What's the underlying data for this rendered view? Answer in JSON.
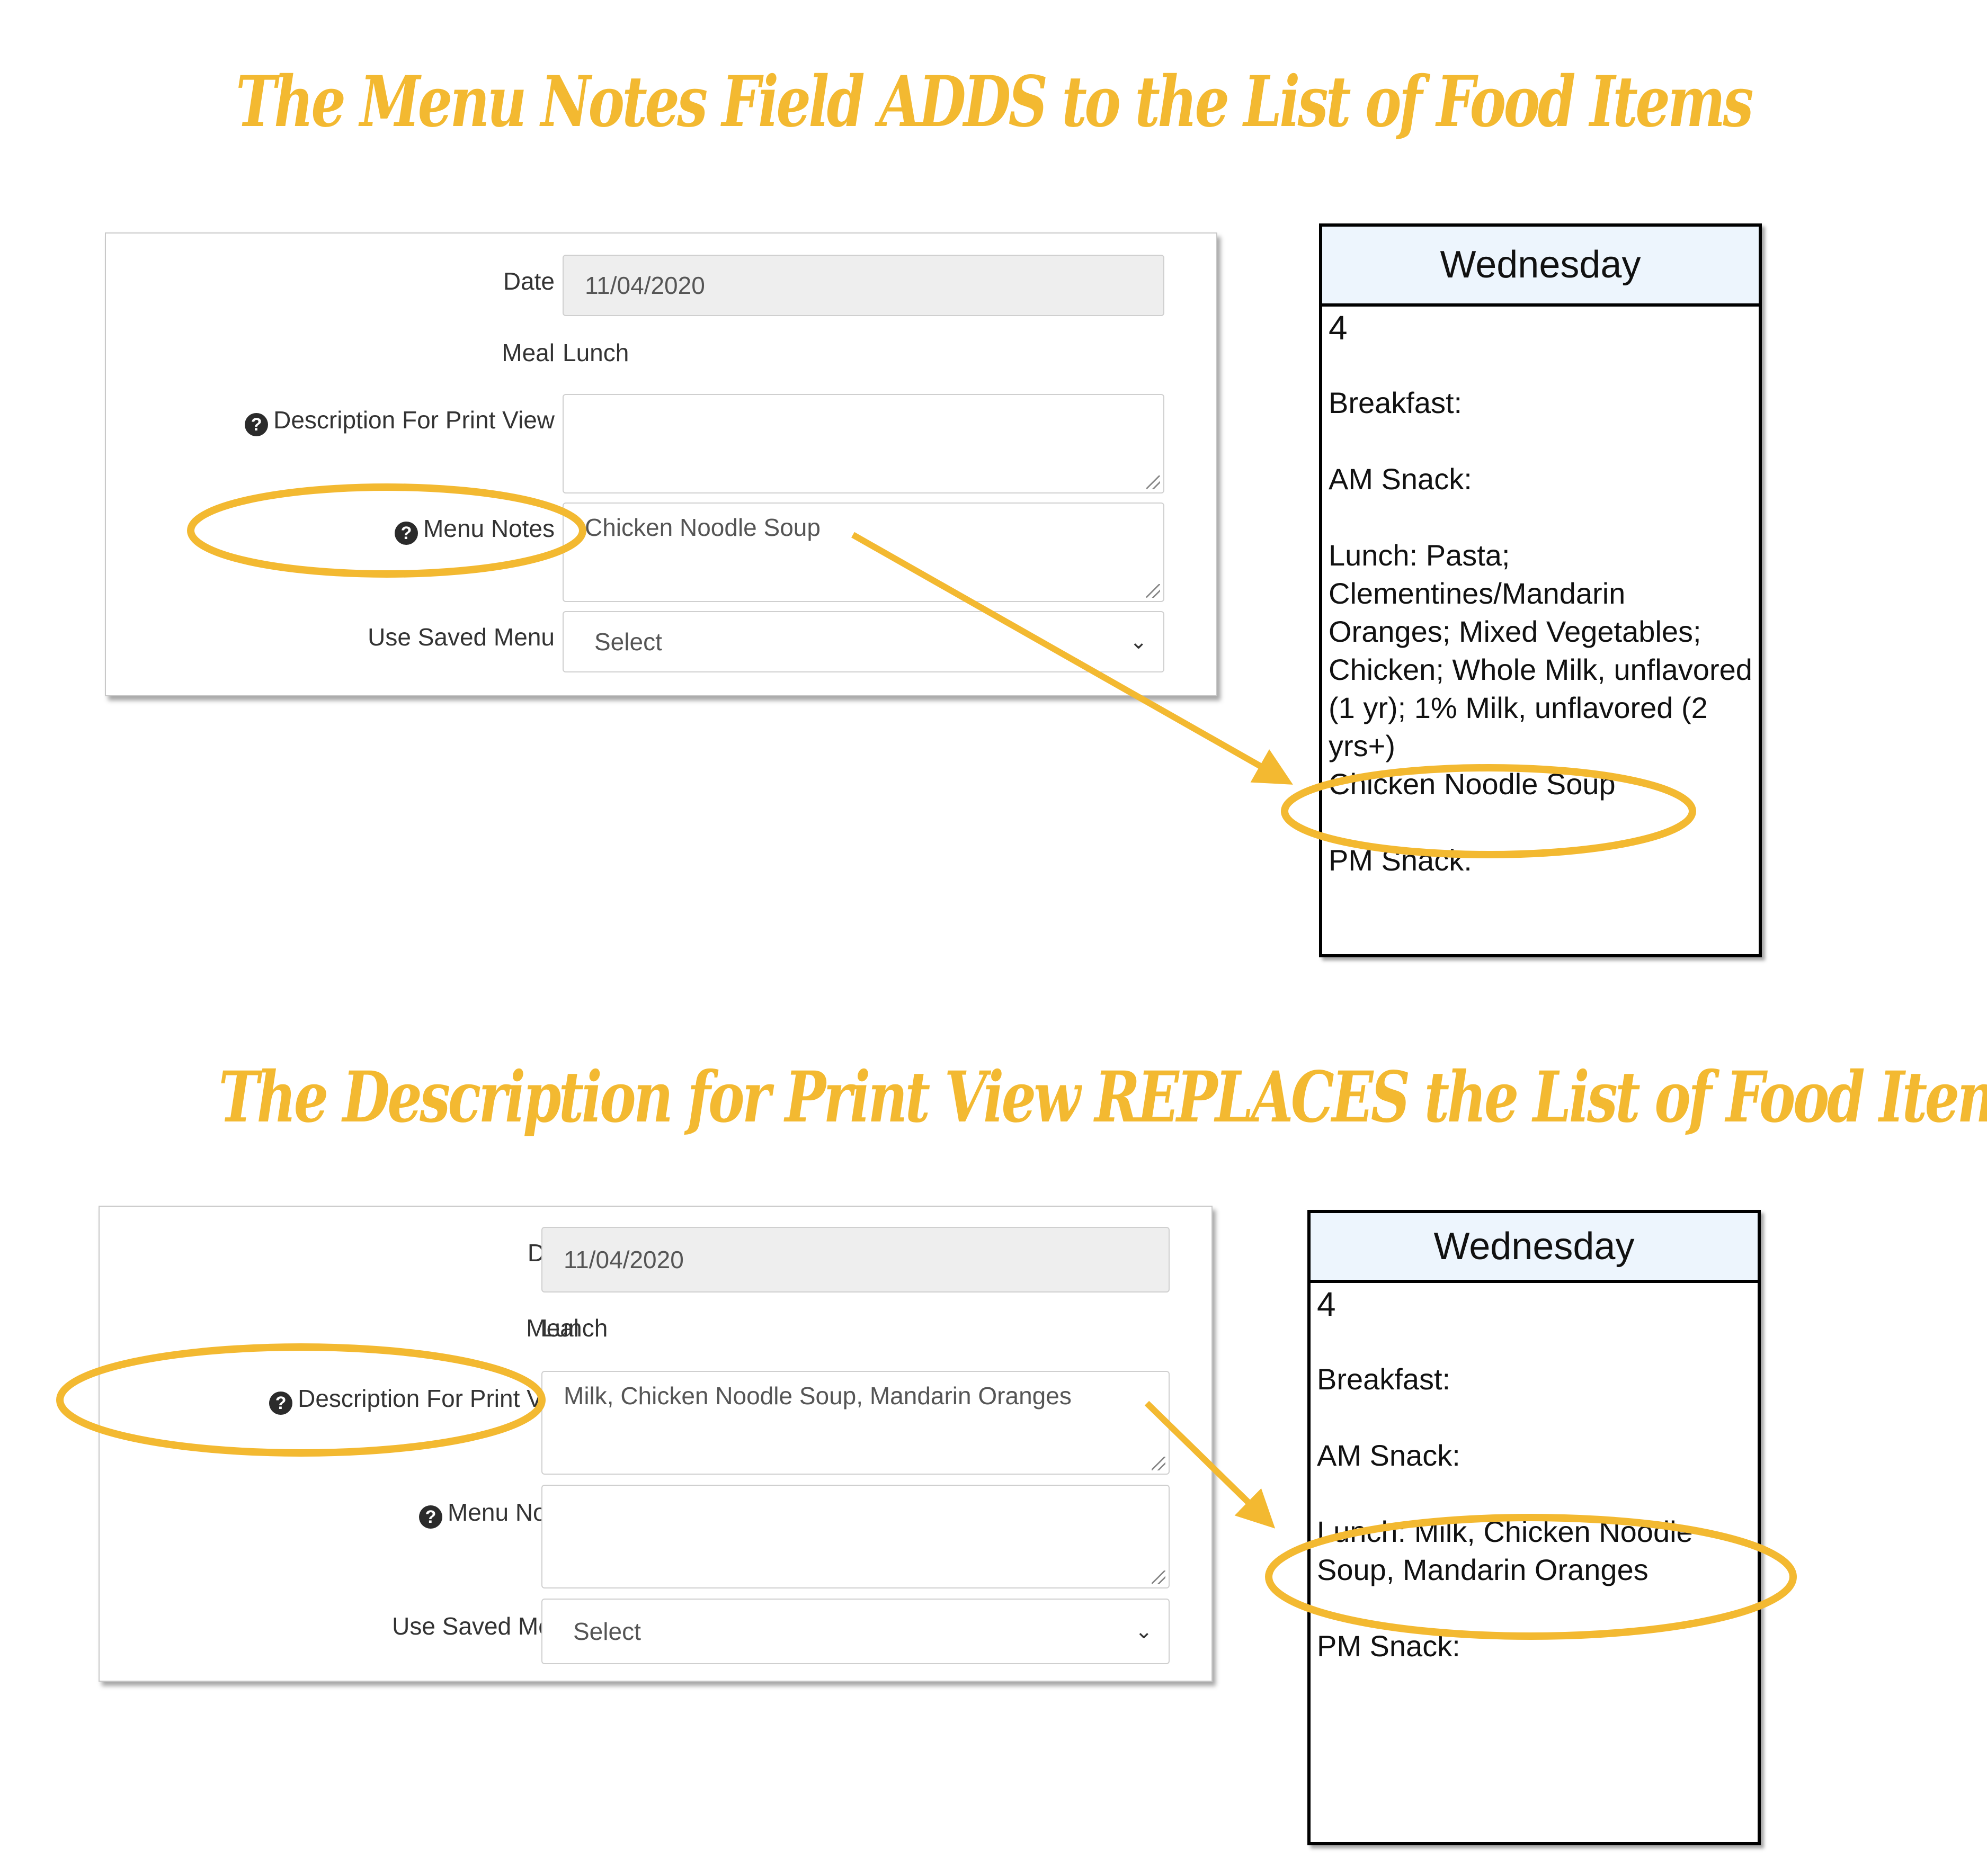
{
  "colors": {
    "accent": "#f3b931",
    "calendar_header_bg": "#edf5fd",
    "readonly_bg": "#eeeeee"
  },
  "sections": [
    {
      "headline": "The Menu Notes Field ADDS to the List of Food Items",
      "form": {
        "date_label": "Date",
        "date_value": "11/04/2020",
        "meal_label": "Meal",
        "meal_value": "Lunch",
        "description_label": "Description For Print View",
        "description_value": "",
        "menu_notes_label": "Menu Notes",
        "menu_notes_value": "Chicken Noodle Soup",
        "saved_menu_label": "Use Saved Menu",
        "saved_menu_value": "Select"
      },
      "calendar": {
        "day": "Wednesday",
        "date": "4",
        "breakfast": "Breakfast:",
        "am_snack": "AM Snack:",
        "lunch": "Lunch: Pasta; Clementines/Mandarin Oranges; Mixed Vegetables; Chicken; Whole Milk, unflavored (1 yr); 1% Milk, unflavored (2 yrs+)",
        "lunch_note": "Chicken Noodle Soup",
        "pm_snack": "PM Snack:"
      }
    },
    {
      "headline": "The Description for Print View REPLACES the List of Food Items",
      "form": {
        "date_label": "Date",
        "date_value": "11/04/2020",
        "meal_label": "Meal",
        "meal_value": "Lunch",
        "description_label": "Description For Print View",
        "description_value": "Milk, Chicken Noodle Soup, Mandarin Oranges",
        "menu_notes_label": "Menu Notes",
        "menu_notes_value": "",
        "saved_menu_label": "Use Saved Menu",
        "saved_menu_value": "Select"
      },
      "calendar": {
        "day": "Wednesday",
        "date": "4",
        "breakfast": "Breakfast:",
        "am_snack": "AM Snack:",
        "lunch": "Lunch: Milk, Chicken Noodle Soup, Mandarin Oranges",
        "pm_snack": "PM Snack:"
      }
    }
  ],
  "icons": {
    "help": "?",
    "chevron": "⌄"
  }
}
